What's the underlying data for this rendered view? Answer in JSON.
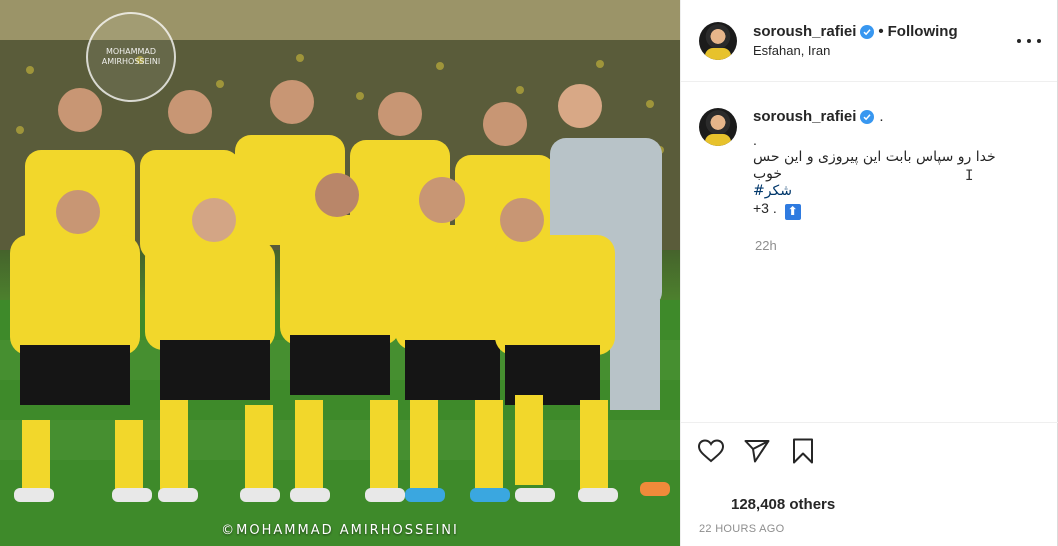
{
  "photo": {
    "watermark_logo_line1": "MOHAMMAD",
    "watermark_logo_line2": "AMIRHOSSEINI",
    "watermark_text": "©MOHAMMAD AMIRHOSSEINI",
    "kit_color": "#f2d72b",
    "shorts_color": "#151515",
    "keeper_color": "#b8c3c8"
  },
  "header": {
    "username": "soroush_rafiei",
    "separator": "•",
    "follow_status": "Following",
    "location": "Esfahan, Iran",
    "more_icon": "more-horizontal-icon"
  },
  "caption": {
    "username": "soroush_rafiei",
    "after_username": ".",
    "line_dot": ".",
    "line_text_1": "خدا رو سپاس بابت این پیروزی و این حس",
    "line_text_2": "خوب",
    "hashtag": "#شکر",
    "line_plus": "+3 .",
    "up_emoji": "⬆",
    "time_ago": "22h"
  },
  "actions": {
    "like_icon": "heart-icon",
    "share_icon": "paper-plane-icon",
    "save_icon": "bookmark-icon"
  },
  "likes_text": "128,408 others",
  "post_age": "22 HOURS AGO",
  "colors": {
    "accent_blue": "#3897f0",
    "text": "#262626",
    "muted": "#8e8e8e",
    "hashtag": "#00376b"
  }
}
